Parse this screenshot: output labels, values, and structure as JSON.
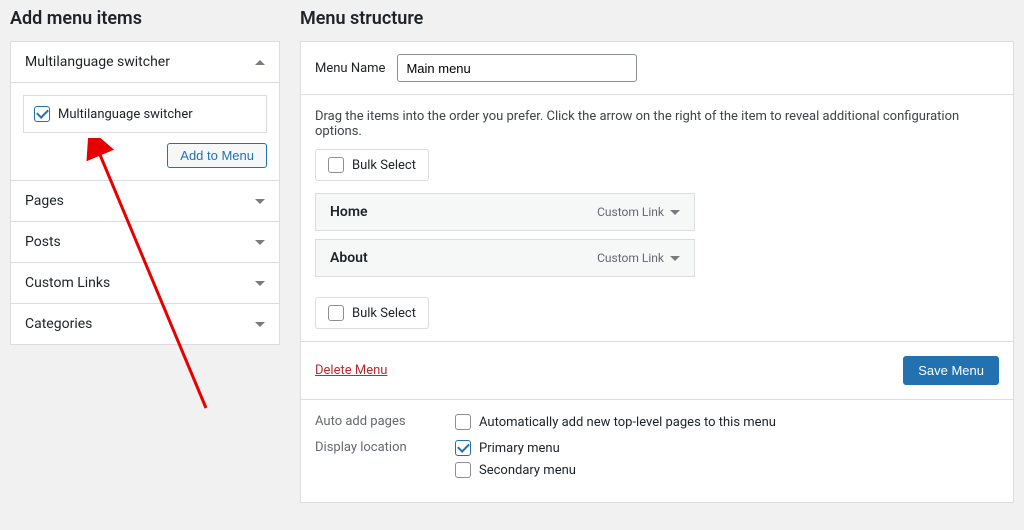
{
  "left": {
    "heading": "Add menu items",
    "panels": {
      "multilang": {
        "title": "Multilanguage switcher",
        "item_label": "Multilanguage switcher",
        "add_button": "Add to Menu"
      },
      "pages": {
        "title": "Pages"
      },
      "posts": {
        "title": "Posts"
      },
      "custom_links": {
        "title": "Custom Links"
      },
      "categories": {
        "title": "Categories"
      }
    }
  },
  "right": {
    "heading": "Menu structure",
    "menu_name_label": "Menu Name",
    "menu_name_value": "Main menu",
    "instruction": "Drag the items into the order you prefer. Click the arrow on the right of the item to reveal additional configuration options.",
    "bulk_select": "Bulk Select",
    "items": [
      {
        "title": "Home",
        "type": "Custom Link"
      },
      {
        "title": "About",
        "type": "Custom Link"
      }
    ],
    "delete": "Delete Menu",
    "save": "Save Menu",
    "settings": {
      "auto_add_label": "Auto add pages",
      "auto_add_option": "Automatically add new top-level pages to this menu",
      "display_label": "Display location",
      "primary": "Primary menu",
      "secondary": "Secondary menu"
    }
  }
}
